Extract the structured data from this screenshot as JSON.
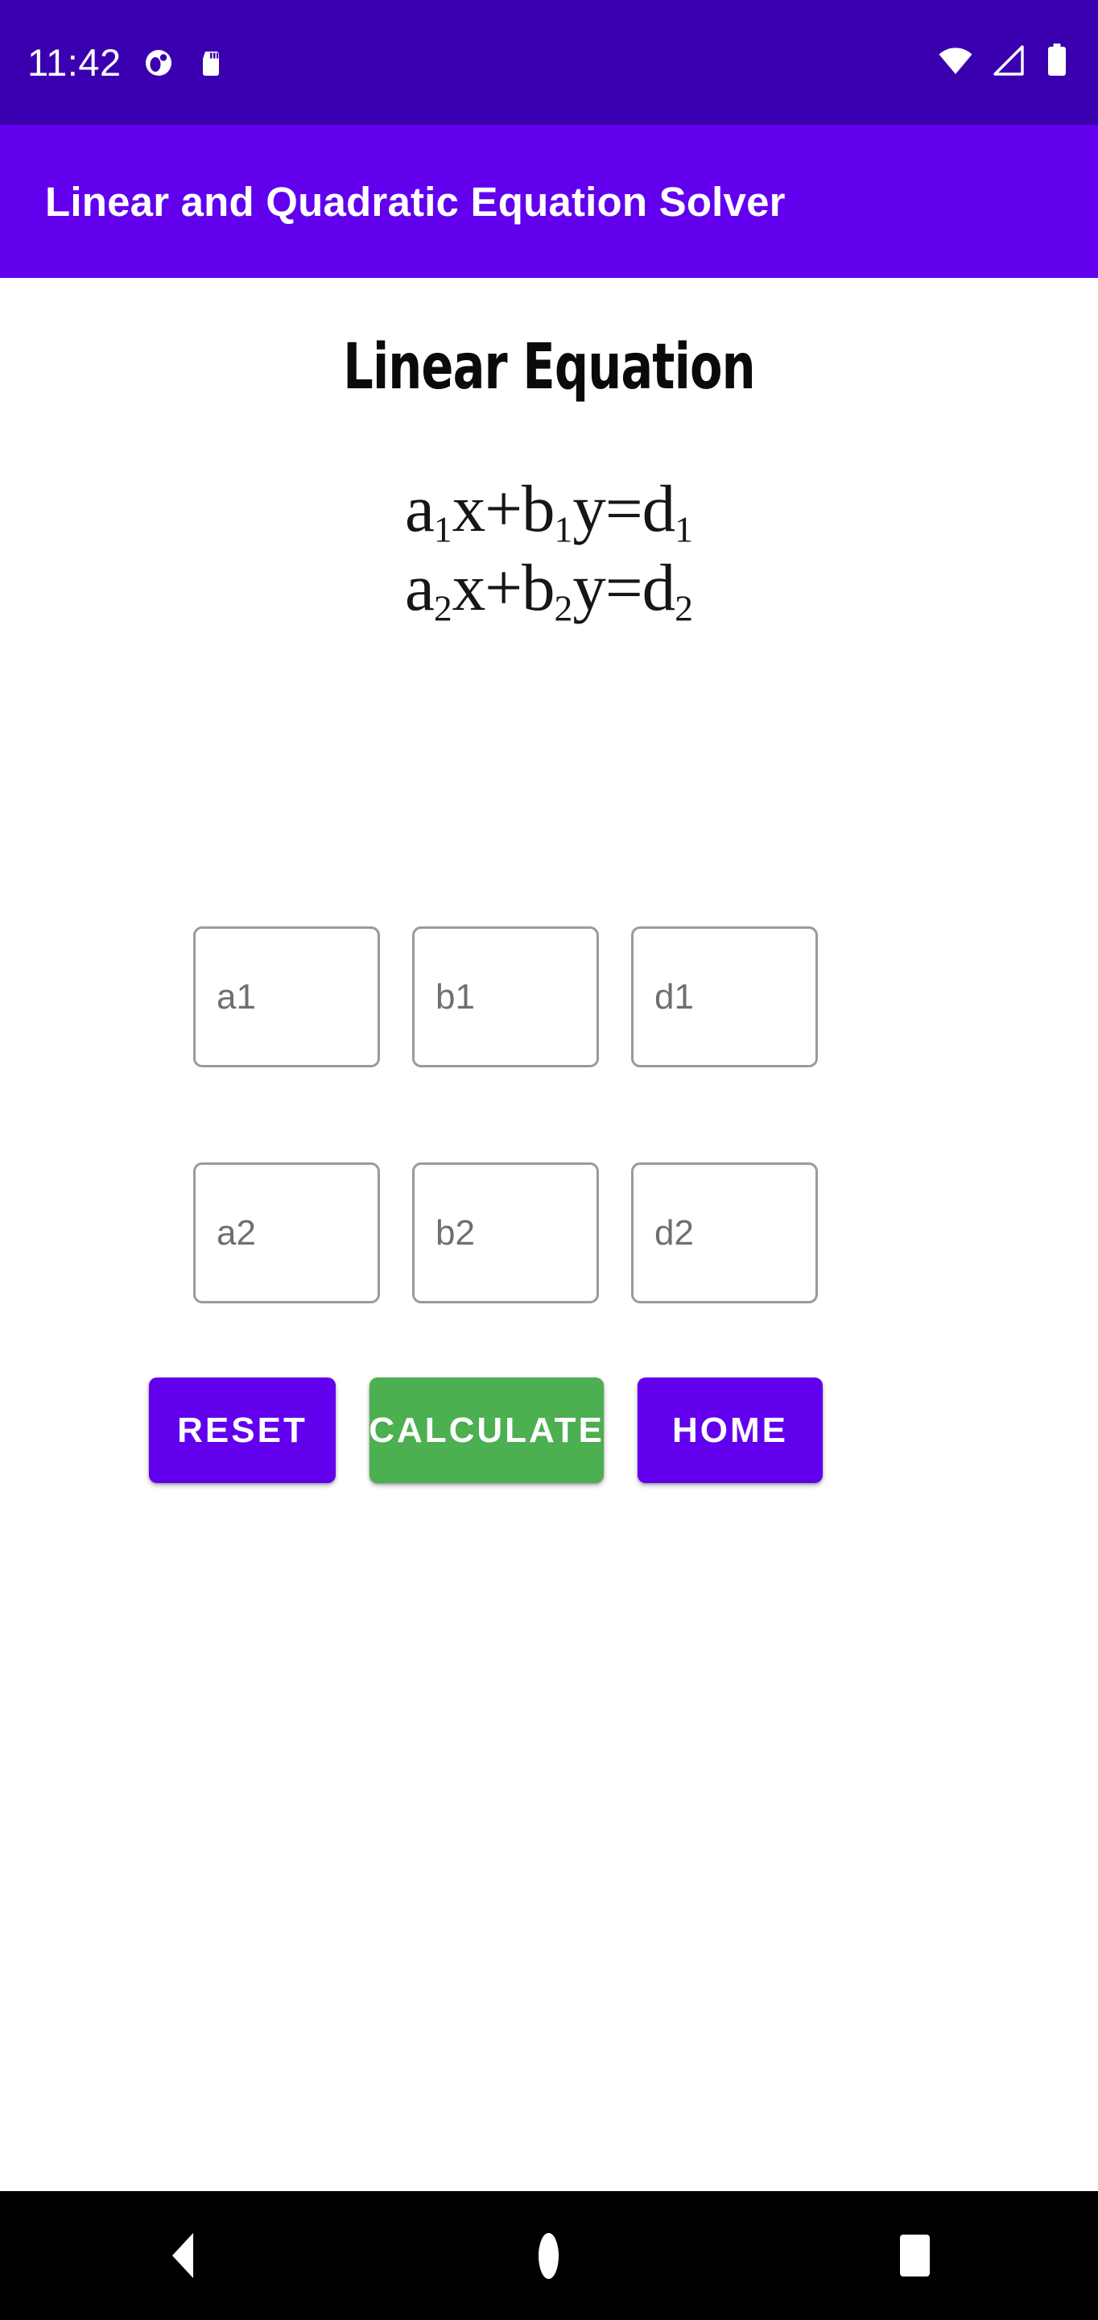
{
  "status_bar": {
    "clock": "11:42",
    "background_color": "#3A00B0",
    "notification_icons": [
      "app-notification-icon",
      "sd-card-icon"
    ],
    "system_icons": [
      "wifi-icon",
      "cellular-signal-icon",
      "battery-icon"
    ]
  },
  "app_bar": {
    "title": "Linear and Quadratic Equation Solver",
    "background_color": "#6200EE",
    "text_color": "#FFFFFF"
  },
  "main": {
    "heading": "Linear Equation",
    "equation": {
      "line1": {
        "a": "a",
        "a_sub": "1",
        "x": "x+",
        "b": "b",
        "b_sub": "1",
        "y": "y=",
        "d": "d",
        "d_sub": "1"
      },
      "line2": {
        "a": "a",
        "a_sub": "2",
        "x": "x+",
        "b": "b",
        "b_sub": "2",
        "y": "y=",
        "d": "d",
        "d_sub": "2"
      },
      "alt_text": "a1x+b1y=d1  a2x+b2y=d2"
    },
    "fields": [
      {
        "name": "a1",
        "placeholder": "a1",
        "value": ""
      },
      {
        "name": "b1",
        "placeholder": "b1",
        "value": ""
      },
      {
        "name": "d1",
        "placeholder": "d1",
        "value": ""
      },
      {
        "name": "a2",
        "placeholder": "a2",
        "value": ""
      },
      {
        "name": "b2",
        "placeholder": "b2",
        "value": ""
      },
      {
        "name": "d2",
        "placeholder": "d2",
        "value": ""
      }
    ],
    "buttons": {
      "reset": {
        "label": "RESET",
        "color": "#6200EE"
      },
      "calculate": {
        "label": "CALCULATE",
        "color": "#4CAF50"
      },
      "home": {
        "label": "HOME",
        "color": "#6200EE"
      }
    }
  },
  "nav_bar": {
    "background_color": "#000000",
    "items": [
      "back-icon",
      "home-icon",
      "recents-icon"
    ]
  }
}
